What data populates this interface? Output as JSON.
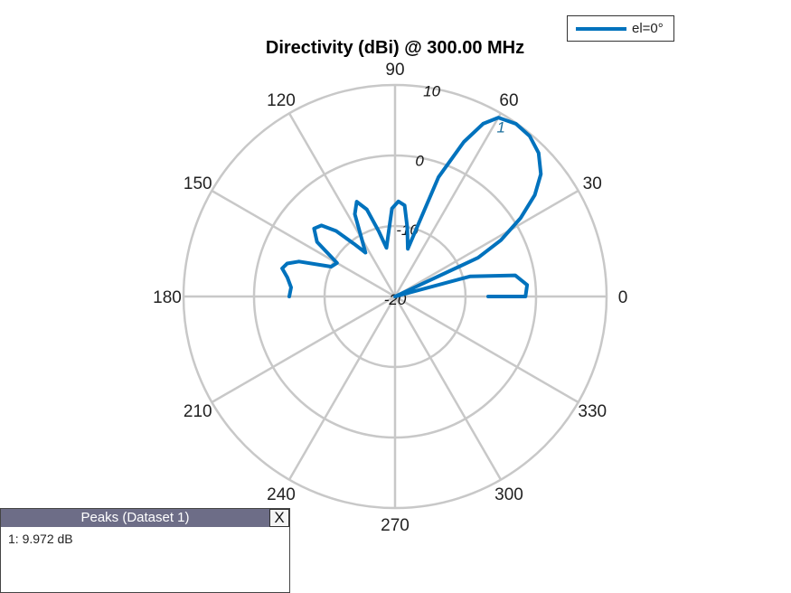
{
  "chart_data": {
    "type": "polar",
    "title": "Directivity (dBi) @ 300.00 MHz",
    "angle_unit": "degrees",
    "angle_ticks": [
      0,
      30,
      60,
      90,
      120,
      150,
      180,
      210,
      240,
      270,
      300,
      330
    ],
    "r_ticks": [
      -20,
      -10,
      0,
      10
    ],
    "r_range": [
      -20,
      10
    ],
    "grid": true,
    "legend_position": "top-right",
    "series": [
      {
        "name": "el=0°",
        "color": "#0072BD",
        "theta": [
          0,
          0,
          5,
          10,
          15,
          20,
          25,
          28,
          32,
          36,
          40,
          45,
          50,
          55,
          60,
          63,
          66,
          70,
          75,
          80,
          84,
          88,
          92,
          96,
          100,
          104,
          108,
          112,
          116,
          120,
          124,
          128,
          132,
          136,
          140,
          145,
          150,
          155,
          160,
          163,
          166,
          170,
          175,
          180
        ],
        "r": [
          -6.8,
          -1.5,
          -1.2,
          -2.7,
          -9,
          -20,
          -7,
          -3,
          1,
          4.5,
          7,
          8.8,
          9.7,
          9.9,
          9.3,
          7.5,
          4,
          -2,
          -13,
          -10,
          -7,
          -6.5,
          -7.5,
          -11,
          -13,
          -10.5,
          -7,
          -5.5,
          -7,
          -10.5,
          -12.5,
          -10.5,
          -7.5,
          -5.5,
          -5,
          -6.5,
          -10.5,
          -10,
          -5.5,
          -4,
          -3.5,
          -4.5,
          -5.2,
          -5
        ]
      }
    ],
    "peak_marker": {
      "label": "1",
      "theta": 58,
      "r": 9.972
    }
  },
  "legend": {
    "label": "el=0°"
  },
  "peaks_panel": {
    "title": "Peaks (Dataset 1)",
    "close_label": "X",
    "rows": [
      "1: 9.972 dB"
    ]
  }
}
